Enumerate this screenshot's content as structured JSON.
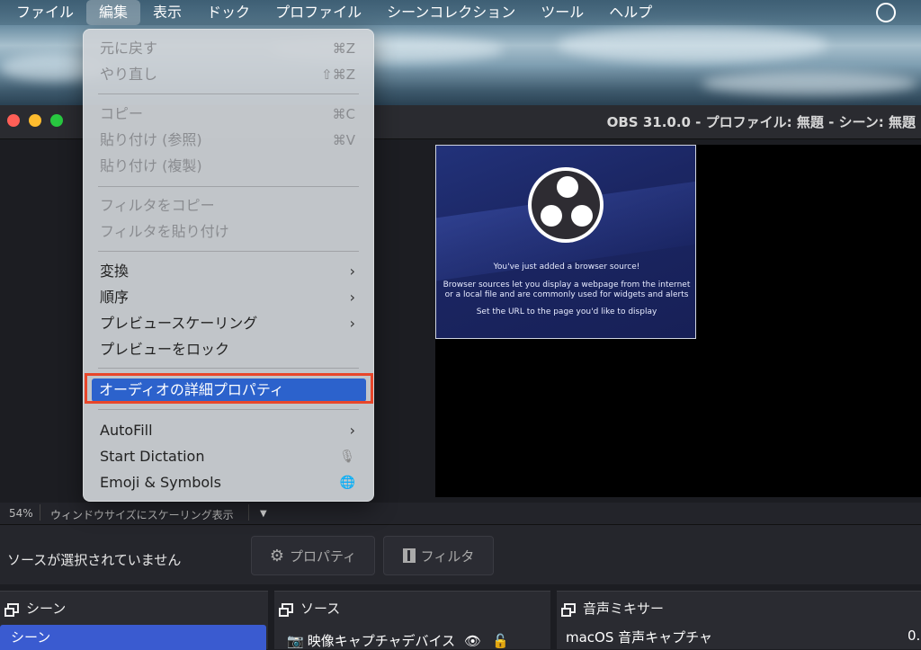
{
  "menubar": {
    "items": [
      "ファイル",
      "編集",
      "表示",
      "ドック",
      "プロファイル",
      "シーンコレクション",
      "ツール",
      "ヘルプ"
    ]
  },
  "window": {
    "title": "OBS 31.0.0 - プロファイル: 無題 - シーン: 無題"
  },
  "edit_menu": {
    "undo": {
      "label": "元に戻す",
      "shortcut": "⌘Z"
    },
    "redo": {
      "label": "やり直し",
      "shortcut": "⇧⌘Z"
    },
    "copy": {
      "label": "コピー",
      "shortcut": "⌘C"
    },
    "paste_ref": {
      "label": "貼り付け (参照)",
      "shortcut": "⌘V"
    },
    "paste_dup": {
      "label": "貼り付け (複製)"
    },
    "copy_filters": {
      "label": "フィルタをコピー"
    },
    "paste_filters": {
      "label": "フィルタを貼り付け"
    },
    "transform": {
      "label": "変換"
    },
    "order": {
      "label": "順序"
    },
    "preview_scaling": {
      "label": "プレビュースケーリング"
    },
    "lock_preview": {
      "label": "プレビューをロック"
    },
    "advanced_audio": {
      "label": "オーディオの詳細プロパティ"
    },
    "autofill": {
      "label": "AutoFill"
    },
    "dictation": {
      "label": "Start Dictation"
    },
    "emoji": {
      "label": "Emoji & Symbols"
    },
    "submenu_arrow": "›"
  },
  "browser_source": {
    "line1": "You've just added a browser source!",
    "line2": "Browser sources let you display a webpage from the internet",
    "line3": "or a local file and are commonly used for widgets and alerts",
    "line4": "Set the URL to the page you'd like to display"
  },
  "statusbar": {
    "zoom": "54%",
    "scaling_mode": "ウィンドウサイズにスケーリング表示"
  },
  "source_toolbar": {
    "no_source": "ソースが選択されていません",
    "properties": "プロパティ",
    "filters": "フィルタ"
  },
  "docks": {
    "scenes": {
      "title": "シーン",
      "item": "シーン"
    },
    "sources": {
      "title": "ソース",
      "item": "映像キャプチャデバイス"
    },
    "mixer": {
      "title": "音声ミキサー",
      "item": "macOS 音声キャプチャ",
      "value": "0."
    }
  },
  "colors": {
    "highlight_outline": "#e8462a",
    "selection_blue": "#2c62cc",
    "scene_selected": "#3a5bd0"
  }
}
